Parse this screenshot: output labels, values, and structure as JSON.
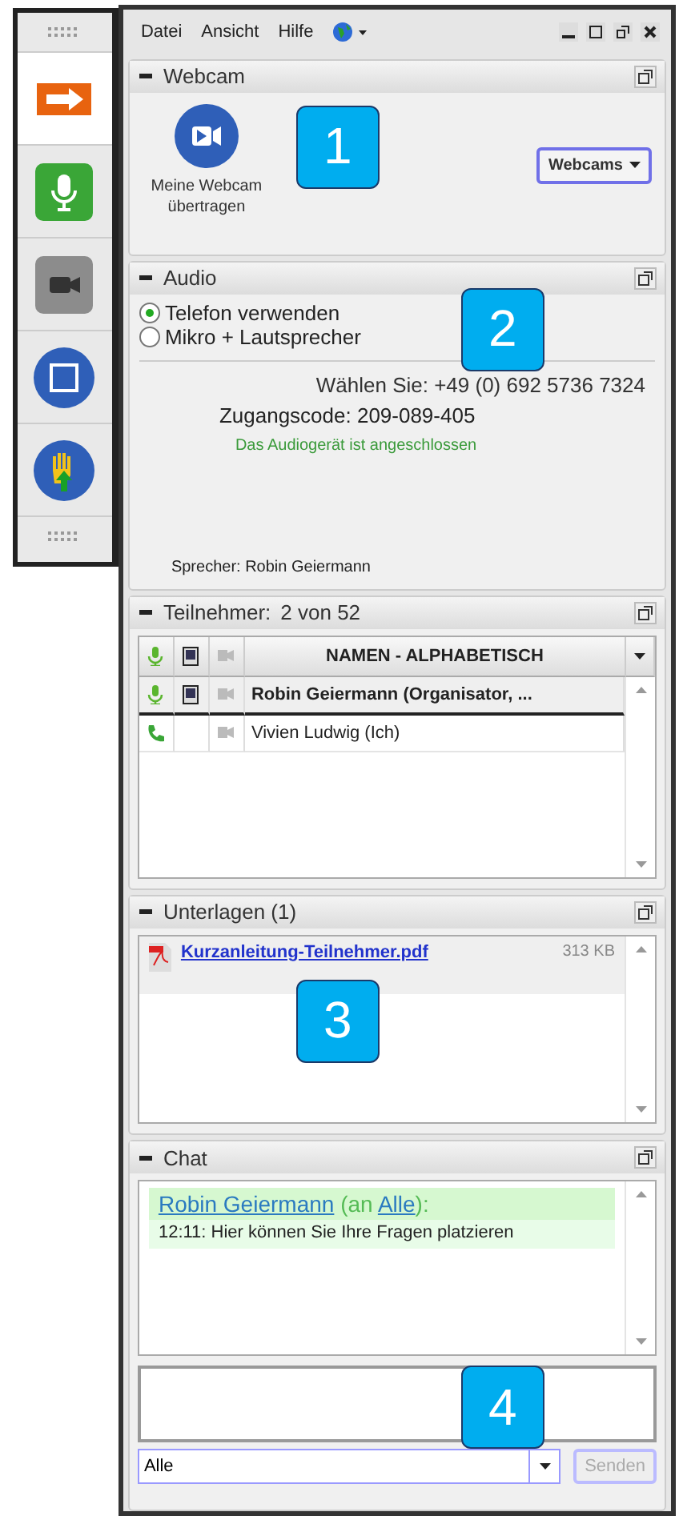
{
  "toolbar": {
    "buttons": [
      {
        "kind": "share",
        "selected": true
      },
      {
        "kind": "mic",
        "selected": false
      },
      {
        "kind": "camera",
        "selected": false
      },
      {
        "kind": "stop",
        "selected": false
      },
      {
        "kind": "hand",
        "selected": false
      }
    ]
  },
  "menu": {
    "items": [
      "Datei",
      "Ansicht",
      "Hilfe"
    ]
  },
  "webcam": {
    "title": "Webcam",
    "button_label": "Meine Webcam übertragen",
    "dropdown": "Webcams",
    "callout": "1"
  },
  "audio": {
    "title": "Audio",
    "options": [
      {
        "label": "Telefon verwenden",
        "selected": true
      },
      {
        "label": "Mikro + Lautsprecher",
        "selected": false
      }
    ],
    "dial": "Wählen Sie: +49 (0) 692 5736 7324",
    "access_code": "Zugangscode: 209-089-405",
    "status": "Das Audiogerät ist angeschlossen",
    "speaker": "Sprecher: Robin Geiermann",
    "callout": "2"
  },
  "participants": {
    "title": "Teilnehmer:",
    "count": "2 von 52",
    "column_header": "NAMEN - ALPHABETISCH",
    "rows": [
      {
        "name": "Robin Geiermann (Organisator, ...",
        "kind": "mic",
        "screen": true,
        "selected": true
      },
      {
        "name": "Vivien Ludwig (Ich)",
        "kind": "phone",
        "screen": false,
        "selected": false
      }
    ]
  },
  "documents": {
    "title": "Unterlagen (1)",
    "files": [
      {
        "name": "Kurzanleitung-Teilnehmer.pdf",
        "size": "313 KB"
      }
    ],
    "callout": "3"
  },
  "chat": {
    "title": "Chat",
    "messages": [
      {
        "sender": "Robin Geiermann",
        "to_open": "(an",
        "recipient": "Alle",
        "to_close": "):",
        "text": "12:11: Hier können Sie Ihre Fragen platzieren"
      }
    ],
    "recipient": "Alle",
    "send_button": {
      "label": "Senden",
      "disabled": true
    },
    "callout": "4"
  }
}
